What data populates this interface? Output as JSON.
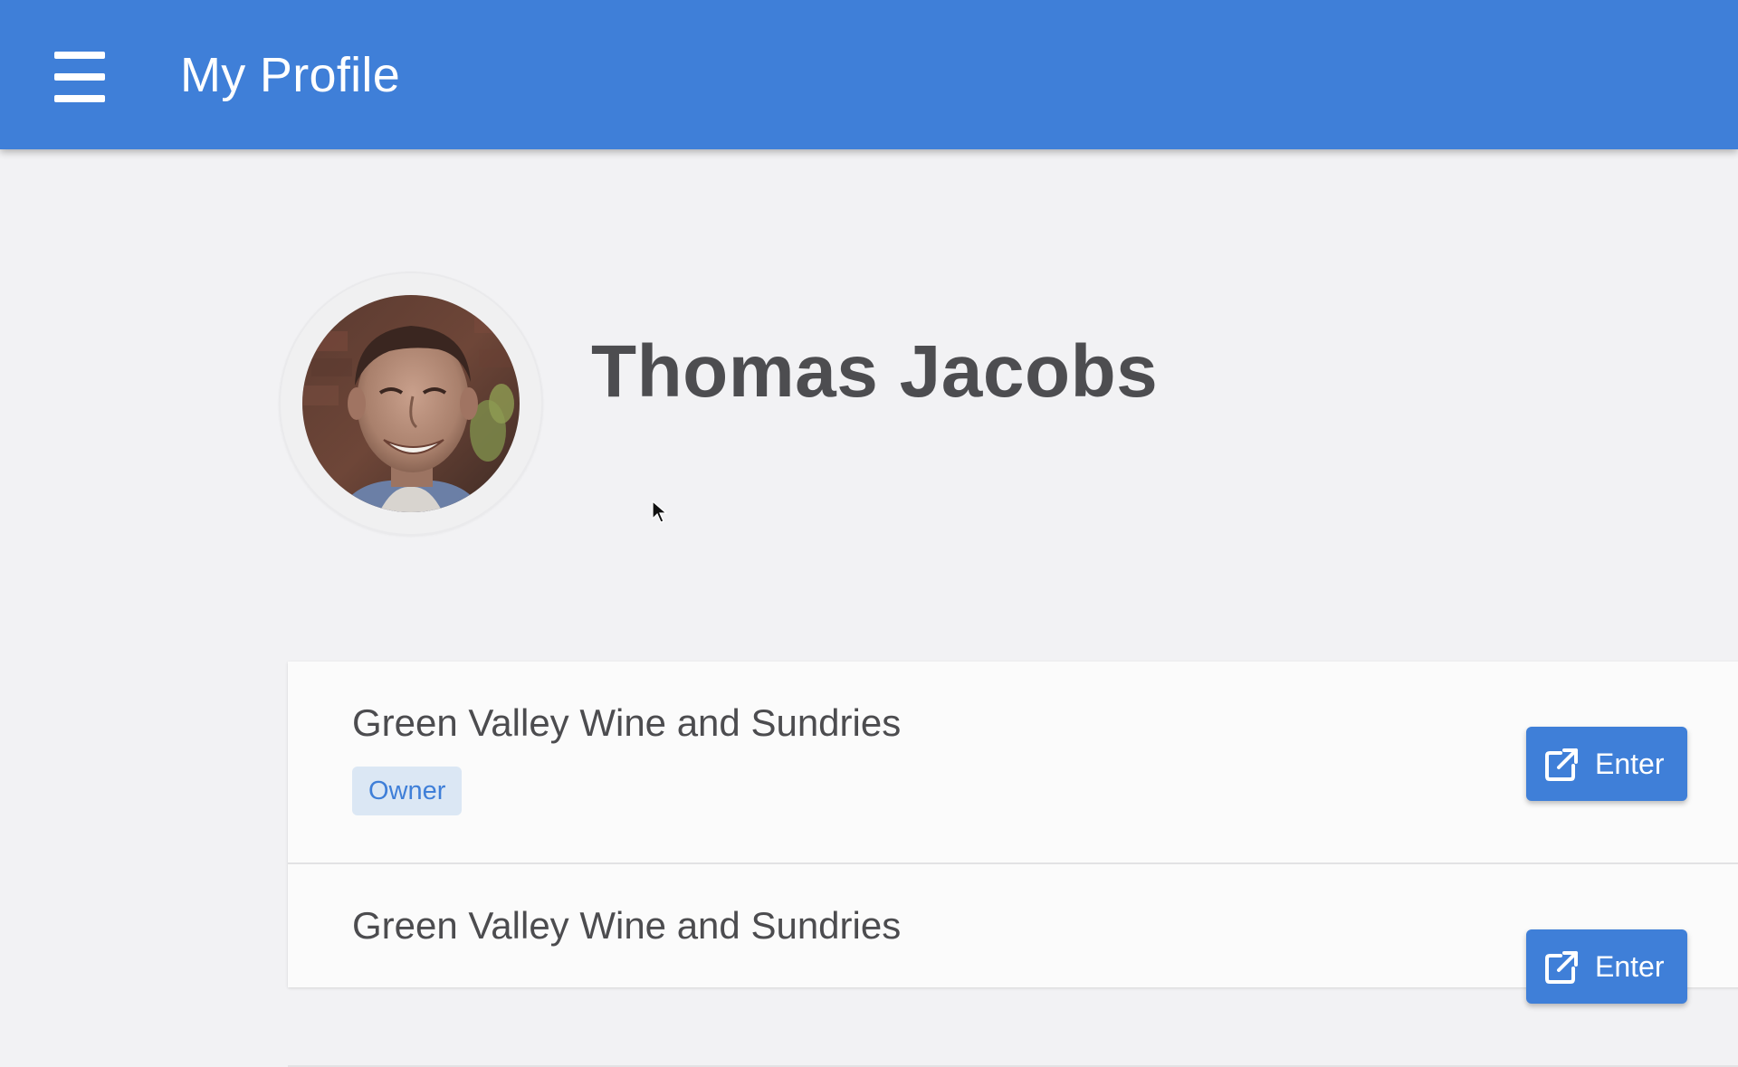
{
  "header": {
    "title": "My Profile",
    "menu_icon": "hamburger-menu-icon",
    "color": "#3f7fd8"
  },
  "profile": {
    "name": "Thomas Jacobs",
    "avatar": "user-avatar-photo"
  },
  "organizations": [
    {
      "name": "Green Valley Wine and Sundries",
      "role": "Owner",
      "action_label": "Enter",
      "action_icon": "external-link-icon"
    },
    {
      "name": "Green Valley Wine and Sundries",
      "role": "",
      "action_label": "Enter",
      "action_icon": "external-link-icon"
    }
  ],
  "colors": {
    "accent": "#3f7fd8",
    "background": "#f2f2f4",
    "badge_bg": "#dbe7f4",
    "text": "#4c4c4f"
  }
}
